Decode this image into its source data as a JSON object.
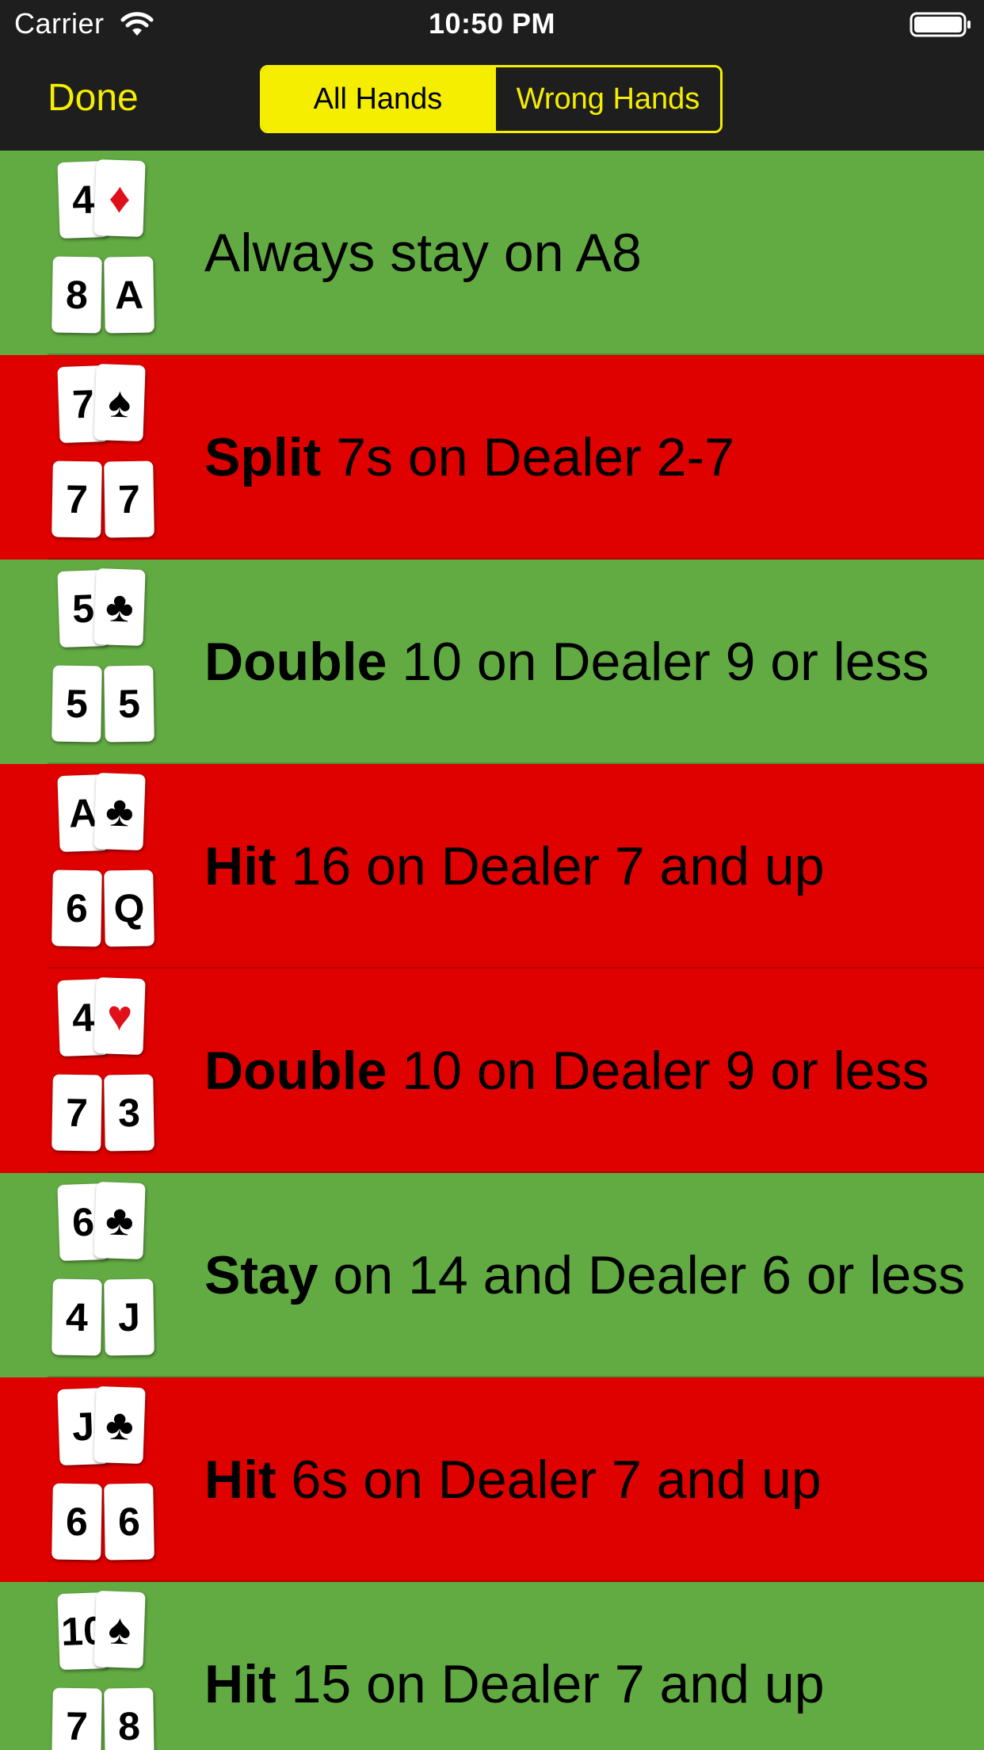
{
  "status_bar": {
    "carrier": "Carrier",
    "time": "10:50 PM",
    "wifi_icon": "wifi-icon",
    "battery_icon": "battery-icon"
  },
  "nav": {
    "done_label": "Done",
    "segments": [
      {
        "label": "All Hands",
        "selected": true
      },
      {
        "label": "Wrong Hands",
        "selected": false
      }
    ]
  },
  "colors": {
    "accent": "#f5ee00",
    "correct": "#62ab43",
    "wrong": "#df0000"
  },
  "hands": [
    {
      "status": "correct",
      "dealer_hole": "4",
      "dealer_up": "♦",
      "dealer_up_color": "red",
      "player": [
        "8",
        "A"
      ],
      "action": "",
      "advice": "Always stay on A8"
    },
    {
      "status": "wrong",
      "dealer_hole": "7",
      "dealer_up": "♠",
      "dealer_up_color": "black",
      "player": [
        "7",
        "7"
      ],
      "action": "Split",
      "advice": " 7s on Dealer 2-7"
    },
    {
      "status": "correct",
      "dealer_hole": "5",
      "dealer_up": "♣",
      "dealer_up_color": "black",
      "player": [
        "5",
        "5"
      ],
      "action": "Double",
      "advice": " 10 on Dealer 9 or less"
    },
    {
      "status": "wrong",
      "dealer_hole": "A",
      "dealer_up": "♣",
      "dealer_up_color": "black",
      "player": [
        "6",
        "Q"
      ],
      "action": "Hit",
      "advice": " 16 on Dealer 7 and up"
    },
    {
      "status": "wrong",
      "dealer_hole": "4",
      "dealer_up": "♥",
      "dealer_up_color": "red",
      "player": [
        "7",
        "3"
      ],
      "action": "Double",
      "advice": " 10 on Dealer 9 or less"
    },
    {
      "status": "correct",
      "dealer_hole": "6",
      "dealer_up": "♣",
      "dealer_up_color": "black",
      "player": [
        "4",
        "J"
      ],
      "action": "Stay",
      "advice": " on 14 and Dealer 6 or less"
    },
    {
      "status": "wrong",
      "dealer_hole": "J",
      "dealer_up": "♣",
      "dealer_up_color": "black",
      "player": [
        "6",
        "6"
      ],
      "action": "Hit",
      "advice": " 6s on Dealer 7 and up"
    },
    {
      "status": "correct",
      "dealer_hole": "10",
      "dealer_up": "♠",
      "dealer_up_color": "black",
      "player": [
        "7",
        "8"
      ],
      "action": "Hit",
      "advice": " 15 on Dealer 7 and up"
    }
  ]
}
